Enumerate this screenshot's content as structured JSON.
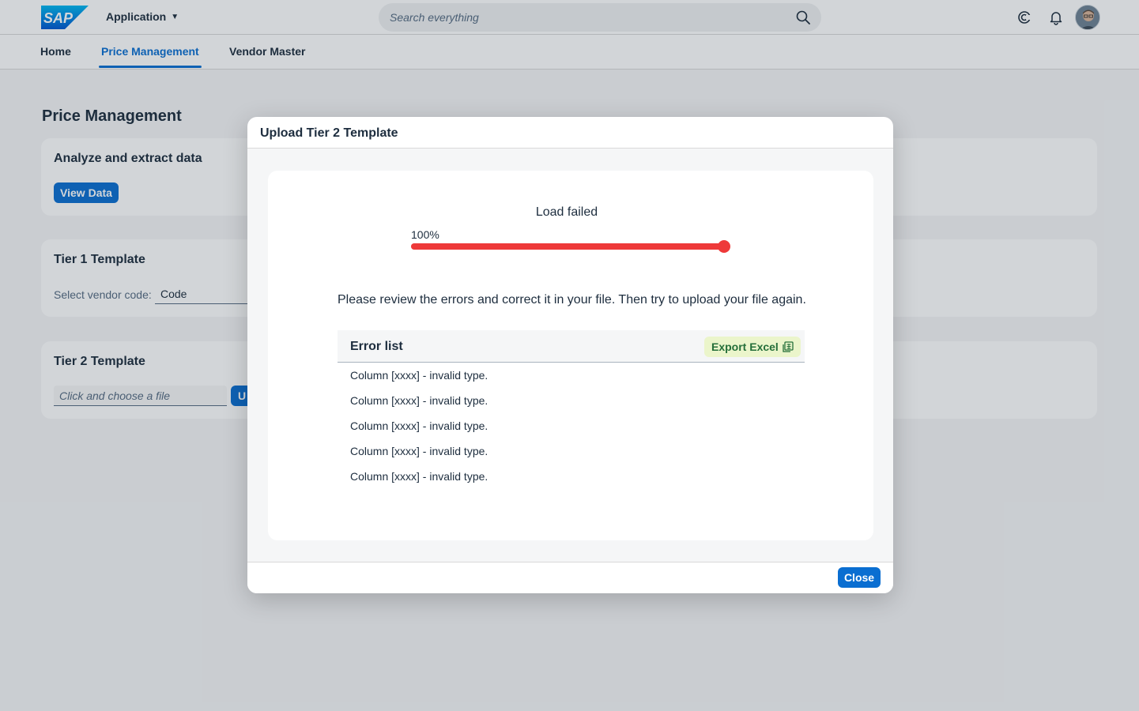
{
  "shell": {
    "logo_text": "SAP",
    "app_title": "Application",
    "search_placeholder": "Search everything",
    "icons": [
      "search-icon",
      "copilot-icon",
      "notification-bell-icon",
      "user-avatar"
    ]
  },
  "tabs": [
    {
      "label": "Home",
      "active": false
    },
    {
      "label": "Price Management",
      "active": true
    },
    {
      "label": "Vendor Master",
      "active": false
    }
  ],
  "page": {
    "title": "Price Management",
    "analyze_card": {
      "title": "Analyze and extract data",
      "button": "View Data"
    },
    "tier1_card": {
      "title": "Tier 1 Template",
      "vendor_label": "Select vendor code:",
      "vendor_value": "Code"
    },
    "tier2_card": {
      "title": "Tier 2 Template",
      "file_placeholder": "Click and choose a file",
      "upload_button_partial": "U"
    }
  },
  "dialog": {
    "title": "Upload Tier 2 Template",
    "status": "Load failed",
    "progress_label": "100%",
    "progress_value": 1.0,
    "message": "Please review the errors and correct it in your file. Then try to upload your file again.",
    "error_list_title": "Error list",
    "export_button": "Export Excel",
    "errors": [
      "Column [xxxx] - invalid type.",
      "Column [xxxx] - invalid type.",
      "Column [xxxx] - invalid type.",
      "Column [xxxx] - invalid type.",
      "Column [xxxx] - invalid type."
    ],
    "close_button": "Close"
  },
  "colors": {
    "brand": "#0a6ed1",
    "error": "#ee3939",
    "export_bg": "#ebf5cb",
    "export_text": "#256f3a"
  }
}
